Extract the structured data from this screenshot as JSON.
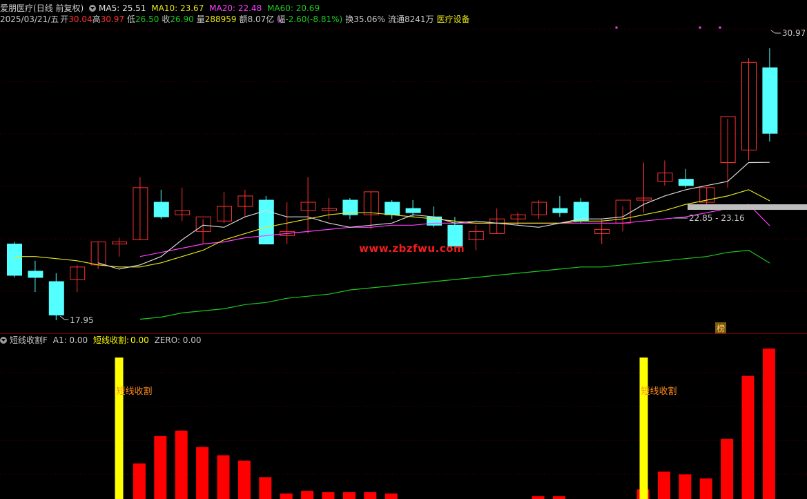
{
  "header": {
    "stock_name": "爱朋医疗",
    "period_label": "(日线 前复权)",
    "ma5": "MA5: 25.51",
    "ma10": "MA10: 23.67",
    "ma20": "MA20: 22.48",
    "ma60": "MA60: 20.69",
    "date": "2025/03/21/五",
    "open_label": "开",
    "open_value": "30.04",
    "high_label": "高",
    "high_value": "30.97",
    "low_label": "低",
    "low_value": "26.50",
    "close_label": "收",
    "close_value": "26.90",
    "volume_label": "量",
    "volume_value": "288959",
    "amount_label": "额",
    "amount_value": "8.07亿",
    "change_label": "幅",
    "change_value": "-2.60(-8.81%)",
    "turnover": "换35.06%",
    "float_shares": "流通8241万",
    "sector": "医疗设备"
  },
  "indicator_header": {
    "name": "短线收割F",
    "a1": "A1: 0.00",
    "line_name": "短线收割:",
    "line_value": "0.00",
    "zero": "ZERO: 0.00"
  },
  "annotations": {
    "high_mark": "30.97",
    "low_mark": "17.95",
    "range_mark": "22.85 - 23.16",
    "badge": "榜",
    "signal_label": "短线收割",
    "watermark": "www.zbzfwu.com"
  },
  "colors": {
    "up": "#ff3232",
    "down": "#54ffff",
    "ma5": "#d8d8d8",
    "ma10": "#e6e61a",
    "ma20": "#ff40ff",
    "ma60": "#1fc81f",
    "signal": "#ffff00",
    "bar": "#ff0000",
    "grid": "#5a0000"
  },
  "chart_data": [
    {
      "type": "candlestick",
      "title": "爱朋医疗 (日线 前复权)",
      "ylim": [
        16.5,
        32.5
      ],
      "candles": [
        {
          "o": 21.6,
          "h": 21.7,
          "l": 20.0,
          "c": 20.1
        },
        {
          "o": 20.3,
          "h": 20.8,
          "l": 19.3,
          "c": 20.0
        },
        {
          "o": 19.8,
          "h": 20.2,
          "l": 17.95,
          "c": 18.2
        },
        {
          "o": 19.9,
          "h": 20.6,
          "l": 19.3,
          "c": 20.5
        },
        {
          "o": 20.6,
          "h": 21.7,
          "l": 20.4,
          "c": 21.7
        },
        {
          "o": 21.6,
          "h": 21.9,
          "l": 21.0,
          "c": 21.7
        },
        {
          "o": 21.8,
          "h": 24.8,
          "l": 21.8,
          "c": 24.3
        },
        {
          "o": 23.6,
          "h": 24.2,
          "l": 22.8,
          "c": 22.9
        },
        {
          "o": 23.0,
          "h": 24.3,
          "l": 22.7,
          "c": 23.2
        },
        {
          "o": 22.2,
          "h": 22.8,
          "l": 21.6,
          "c": 22.9
        },
        {
          "o": 22.7,
          "h": 24.1,
          "l": 22.6,
          "c": 23.4
        },
        {
          "o": 23.4,
          "h": 24.2,
          "l": 22.9,
          "c": 23.9
        },
        {
          "o": 23.7,
          "h": 23.9,
          "l": 21.6,
          "c": 21.6
        },
        {
          "o": 22.0,
          "h": 23.6,
          "l": 21.6,
          "c": 22.2
        },
        {
          "o": 23.2,
          "h": 24.8,
          "l": 22.1,
          "c": 23.6
        },
        {
          "o": 23.2,
          "h": 23.8,
          "l": 22.8,
          "c": 23.3
        },
        {
          "o": 23.7,
          "h": 23.8,
          "l": 22.8,
          "c": 23.0
        },
        {
          "o": 23.0,
          "h": 24.1,
          "l": 22.3,
          "c": 24.1
        },
        {
          "o": 23.6,
          "h": 23.7,
          "l": 22.8,
          "c": 23.0
        },
        {
          "o": 23.3,
          "h": 23.7,
          "l": 22.9,
          "c": 23.1
        },
        {
          "o": 22.9,
          "h": 23.4,
          "l": 22.4,
          "c": 22.5
        },
        {
          "o": 22.5,
          "h": 22.9,
          "l": 21.4,
          "c": 21.5
        },
        {
          "o": 21.8,
          "h": 22.5,
          "l": 21.3,
          "c": 22.2
        },
        {
          "o": 22.1,
          "h": 23.3,
          "l": 22.1,
          "c": 22.8
        },
        {
          "o": 22.8,
          "h": 23.1,
          "l": 22.5,
          "c": 23.0
        },
        {
          "o": 23.0,
          "h": 23.7,
          "l": 22.8,
          "c": 23.6
        },
        {
          "o": 23.3,
          "h": 23.9,
          "l": 22.9,
          "c": 23.1
        },
        {
          "o": 23.6,
          "h": 23.8,
          "l": 22.6,
          "c": 22.7
        },
        {
          "o": 22.1,
          "h": 22.8,
          "l": 21.6,
          "c": 22.3
        },
        {
          "o": 22.6,
          "h": 23.4,
          "l": 22.2,
          "c": 23.7
        },
        {
          "o": 23.7,
          "h": 25.5,
          "l": 23.1,
          "c": 23.8
        },
        {
          "o": 24.6,
          "h": 25.6,
          "l": 24.4,
          "c": 25.0
        },
        {
          "o": 24.7,
          "h": 25.2,
          "l": 24.3,
          "c": 24.4
        },
        {
          "o": 23.6,
          "h": 24.3,
          "l": 23.5,
          "c": 24.3
        },
        {
          "o": 25.5,
          "h": 27.6,
          "l": 24.3,
          "c": 27.7
        },
        {
          "o": 26.1,
          "h": 30.5,
          "l": 25.6,
          "c": 30.3
        },
        {
          "o": 30.04,
          "h": 30.97,
          "l": 26.5,
          "c": 26.9
        }
      ],
      "ma5": [
        null,
        null,
        null,
        null,
        20.7,
        20.4,
        20.6,
        21.0,
        21.8,
        22.5,
        22.4,
        22.9,
        23.2,
        22.9,
        22.9,
        22.6,
        22.4,
        22.5,
        22.6,
        23.0,
        22.9,
        22.6,
        22.7,
        22.6,
        22.5,
        22.4,
        22.6,
        22.8,
        22.8,
        22.9,
        23.5,
        23.9,
        24.2,
        24.4,
        24.6,
        25.5,
        25.51
      ],
      "ma10": [
        21.0,
        21.0,
        20.9,
        20.8,
        20.6,
        20.5,
        20.5,
        20.7,
        21.0,
        21.3,
        21.8,
        22.1,
        22.4,
        22.6,
        22.8,
        23.0,
        23.1,
        23.1,
        23.0,
        22.9,
        22.8,
        22.7,
        22.6,
        22.6,
        22.6,
        22.6,
        22.6,
        22.7,
        22.7,
        22.8,
        23.0,
        23.2,
        23.5,
        23.7,
        23.9,
        24.2,
        23.67
      ],
      "ma20": [
        null,
        null,
        null,
        null,
        null,
        null,
        21.0,
        21.2,
        21.4,
        21.6,
        21.7,
        21.9,
        22.0,
        22.1,
        22.2,
        22.3,
        22.4,
        22.4,
        22.5,
        22.5,
        22.6,
        22.6,
        22.6,
        22.6,
        22.6,
        22.6,
        22.6,
        22.6,
        22.6,
        22.6,
        22.7,
        22.8,
        22.9,
        23.1,
        23.3,
        23.5,
        22.48
      ],
      "ma60": [
        null,
        null,
        null,
        null,
        null,
        null,
        18.0,
        18.1,
        18.3,
        18.4,
        18.5,
        18.7,
        18.8,
        19.0,
        19.1,
        19.2,
        19.4,
        19.5,
        19.6,
        19.7,
        19.8,
        19.9,
        20.0,
        20.1,
        20.2,
        20.3,
        20.4,
        20.5,
        20.5,
        20.6,
        20.7,
        20.8,
        20.9,
        21.0,
        21.2,
        21.3,
        20.69
      ]
    },
    {
      "type": "bar",
      "title": "短线收割F",
      "series": [
        {
          "name": "短线收割",
          "values": [
            0,
            0,
            0,
            0,
            0,
            0,
            52,
            92,
            100,
            76,
            64,
            56,
            32,
            8,
            12,
            10,
            10,
            10,
            8,
            0,
            0,
            0,
            0,
            0,
            0,
            4,
            4,
            0,
            0,
            0,
            14,
            40,
            36,
            30,
            88,
            180,
            220
          ]
        }
      ],
      "signals": [
        5,
        30
      ],
      "ylim": [
        0,
        240
      ]
    }
  ]
}
